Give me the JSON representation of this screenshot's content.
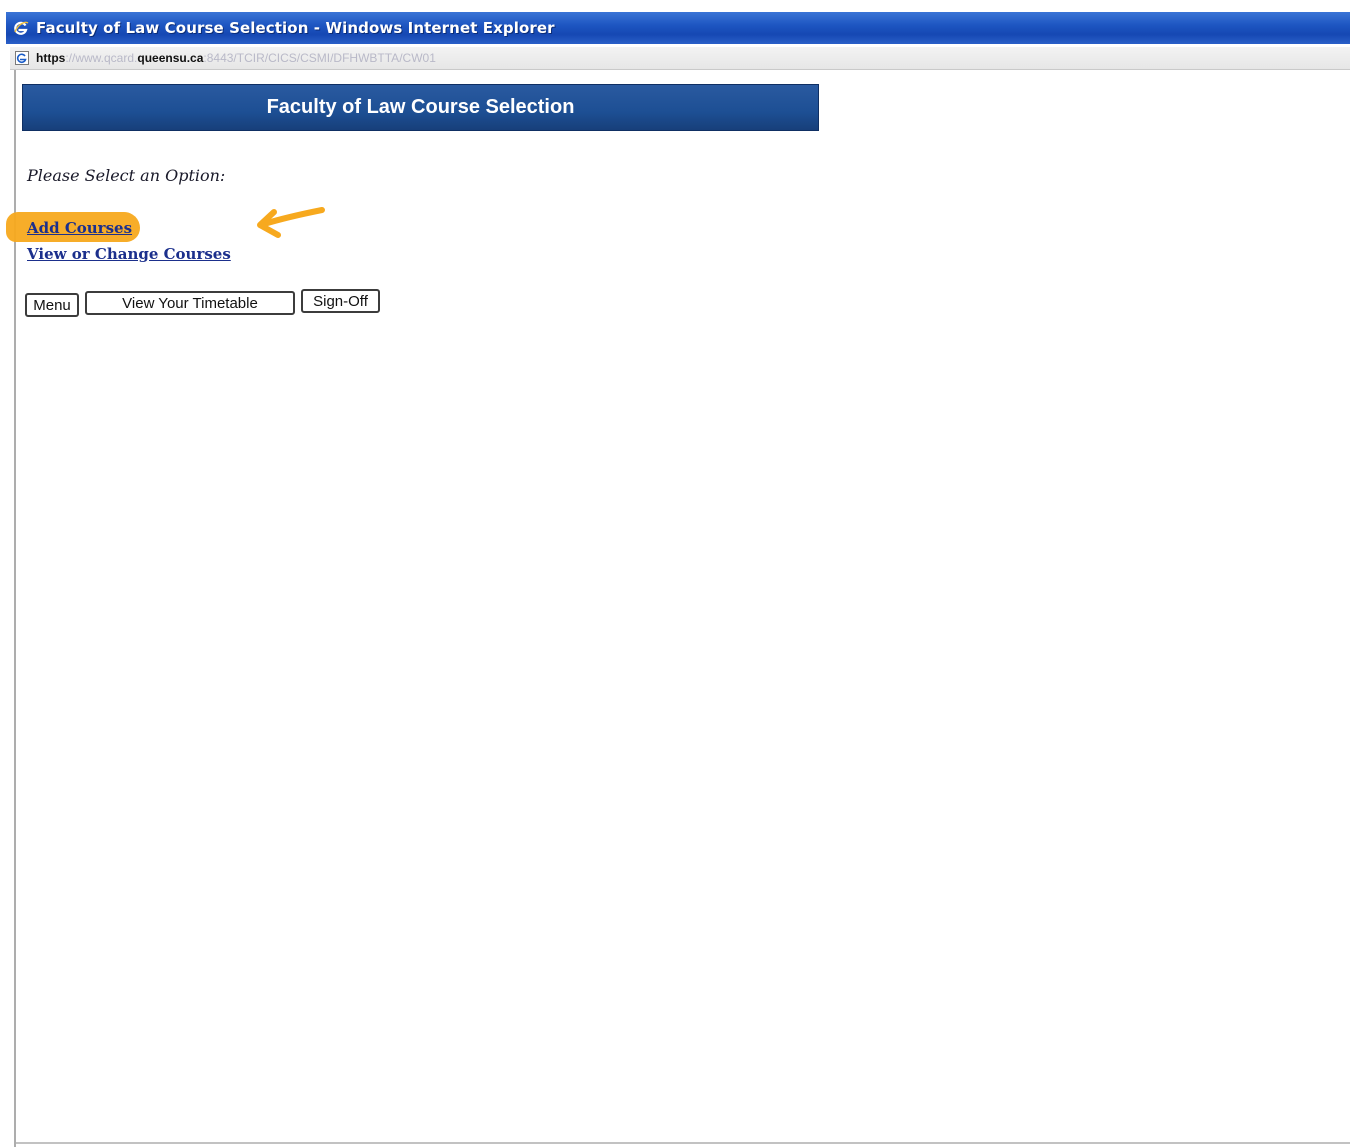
{
  "window": {
    "title": "Faculty of Law Course Selection - Windows Internet Explorer",
    "icon": "ie-logo-icon"
  },
  "address_bar": {
    "url_scheme": "https",
    "url_prefix": "://www.qcard.",
    "url_host": "queensu.ca",
    "url_path": ":8443/TCIR/CICS/CSMI/DFHWBTTA/CW01",
    "icon": "ie-page-icon"
  },
  "page": {
    "banner_title": "Faculty of Law Course Selection",
    "prompt": "Please Select an Option:",
    "links": {
      "add_courses": "Add Courses",
      "view_change_courses": "View or Change Courses"
    },
    "buttons": {
      "menu": "Menu",
      "view_timetable": "View Your Timetable",
      "sign_off": "Sign-Off"
    },
    "annotation": {
      "highlight_color": "#f7a91e",
      "arrow_icon": "hand-drawn-arrow-icon"
    }
  },
  "colors": {
    "titlebar": "#1e56c2",
    "banner": "#1d4f94",
    "link": "#1b2f8c"
  }
}
